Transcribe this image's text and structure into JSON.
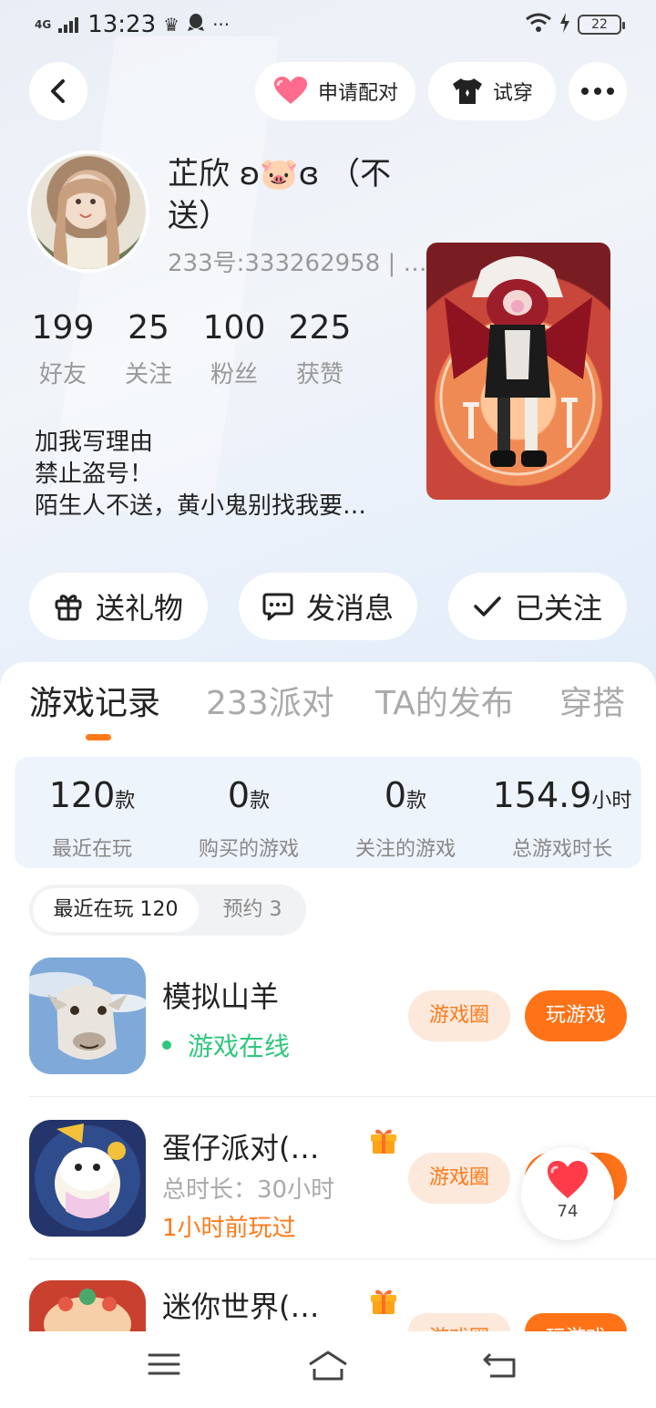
{
  "status_bar": {
    "network": "4G",
    "time": "13:23",
    "battery": "22"
  },
  "header": {
    "apply_pair_label": "申请配对",
    "try_on_label": "试穿"
  },
  "profile": {
    "nickname": "芷欣 ʚ🐷ɞ （不送）",
    "uid": "233号:333262958 | …",
    "stats": [
      {
        "value": "199",
        "label": "好友"
      },
      {
        "value": "25",
        "label": "关注"
      },
      {
        "value": "100",
        "label": "粉丝"
      },
      {
        "value": "225",
        "label": "获赞"
      }
    ],
    "bio": [
      "加我写理由",
      "禁止盗号！",
      "陌生人不送，黄小鬼别找我要…"
    ]
  },
  "actions": {
    "gift_label": "送礼物",
    "message_label": "发消息",
    "followed_label": "已关注"
  },
  "tabs": [
    "游戏记录",
    "233派对",
    "TA的发布",
    "穿搭"
  ],
  "game_stats": [
    {
      "value": "120",
      "unit": "款",
      "label": "最近在玩"
    },
    {
      "value": "0",
      "unit": "款",
      "label": "购买的游戏"
    },
    {
      "value": "0",
      "unit": "款",
      "label": "关注的游戏"
    },
    {
      "value": "154.9",
      "unit": "小时",
      "label": "总游戏时长"
    }
  ],
  "segment": {
    "recent": "最近在玩 120",
    "reserve": "预约 3"
  },
  "games": [
    {
      "name": "模拟山羊",
      "status": "游戏在线",
      "circle_label": "游戏圈",
      "play_label": "玩游戏"
    },
    {
      "name": "蛋仔派对(…",
      "duration": "总时长：30小时",
      "last_played": "1小时前玩过",
      "circle_label": "游戏圈",
      "play_label": "玩游戏"
    },
    {
      "name": "迷你世界(…",
      "circle_label": "游戏圈",
      "play_label": "玩游戏"
    }
  ],
  "like": {
    "count": "74"
  },
  "colors": {
    "accent": "#ff7318",
    "online": "#2fc77d",
    "like": "#ff3b4a"
  }
}
